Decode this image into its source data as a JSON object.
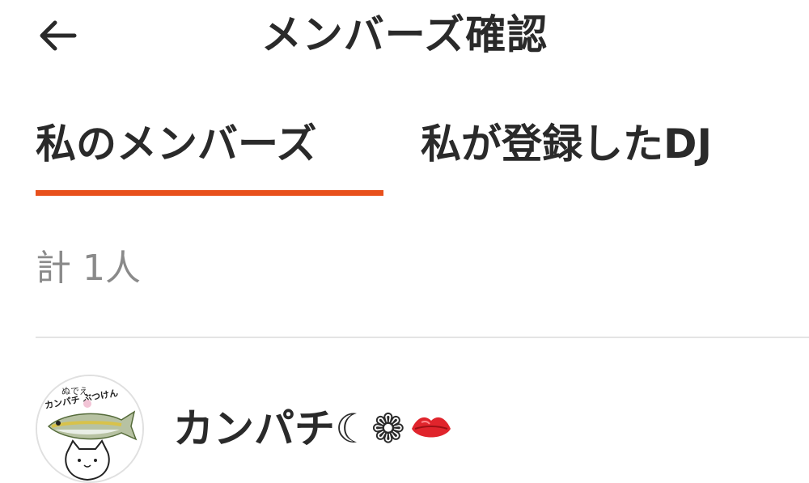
{
  "header": {
    "back_icon": "arrow-left-icon",
    "title": "メンバーズ確認"
  },
  "tabs": [
    {
      "label": "私のメンバーズ",
      "selected": true
    },
    {
      "label": "私が登録したDJ",
      "selected": false
    }
  ],
  "accent_color": "#e8501c",
  "count_text": "計 1人",
  "members": [
    {
      "name": "カンパチ☾❁",
      "name_suffix_icon": "lips-icon",
      "avatar_icon": "fish-cat-avatar",
      "avatar_text_top": "ぬでえ",
      "avatar_text_main": "カンパチ ぶつけん"
    }
  ]
}
